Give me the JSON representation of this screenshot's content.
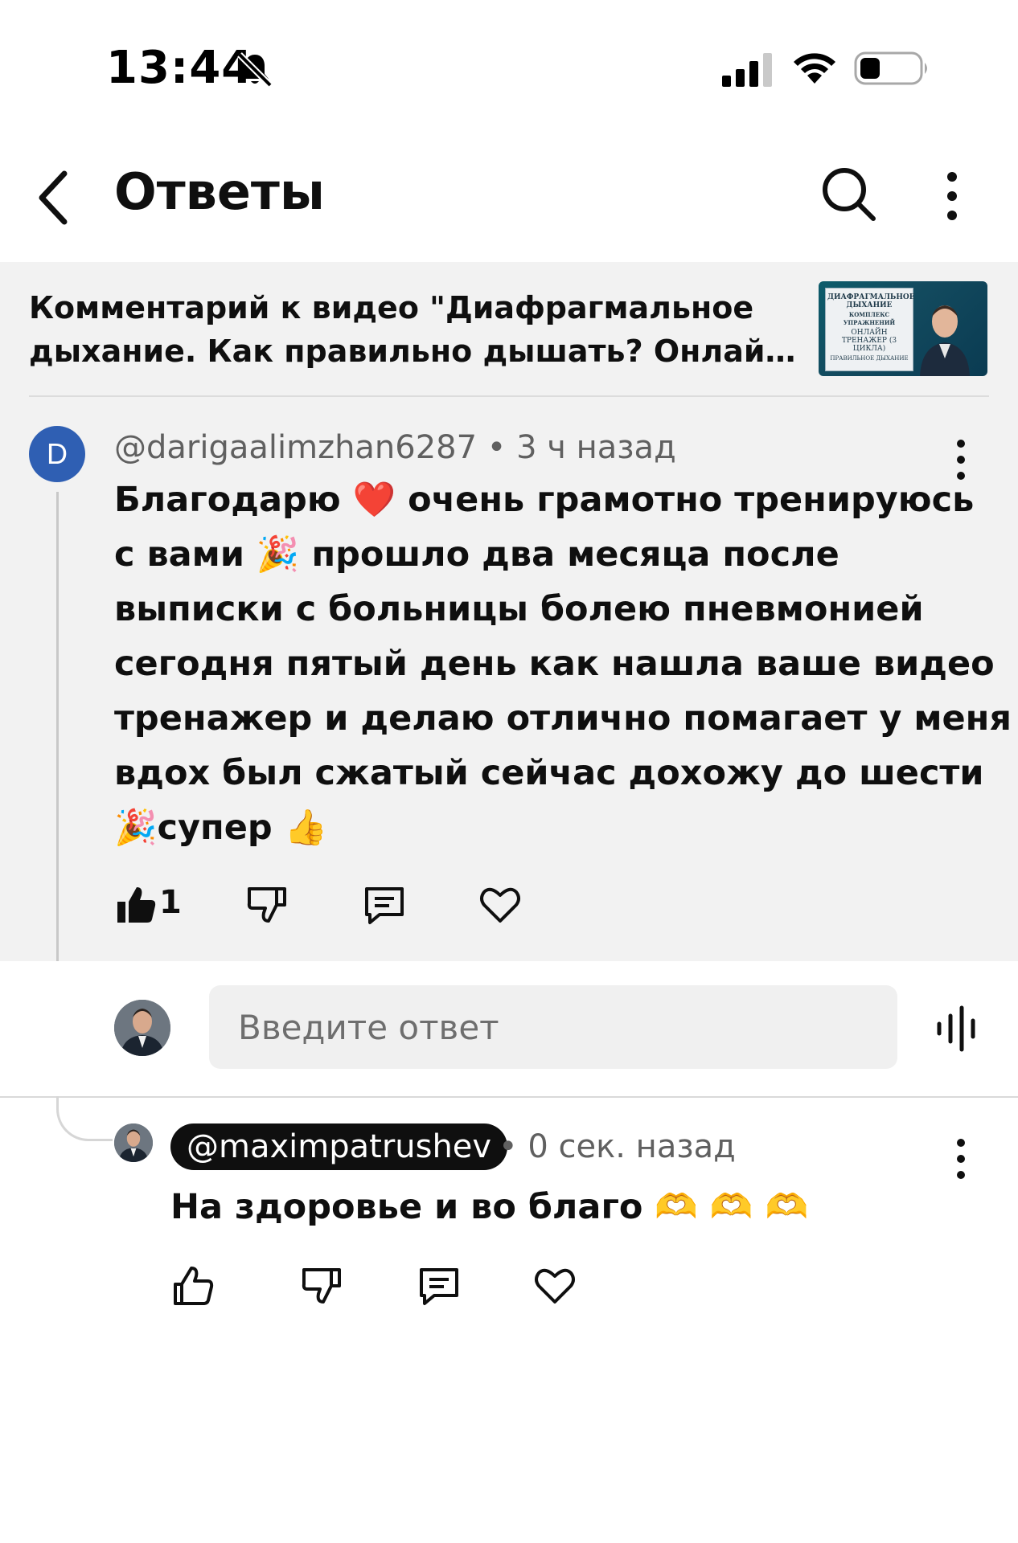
{
  "status_bar": {
    "time": "13:44",
    "icons": [
      "bell-slash-icon",
      "cellular-signal-icon",
      "wifi-icon",
      "battery-icon"
    ]
  },
  "header": {
    "title": "Ответы",
    "icons": [
      "back-arrow-icon",
      "search-icon",
      "more-vertical-icon"
    ]
  },
  "video": {
    "title_line1": "Комментарий к видео \"Диафрагмальное",
    "title_line2": "дыхание. Как правильно дышать? Онлайн-т...",
    "thumbnail": {
      "line1": "ДИАФРАГМАЛЬНОЕ ДЫХАНИЕ",
      "line2": "КОМПЛЕКС УПРАЖНЕНИЙ",
      "line3": "ОНЛАЙН ТРЕНАЖЕР (3 ЦИКЛА)",
      "line4": "ПРАВИЛЬНОЕ ДЫХАНИЕ"
    }
  },
  "comment": {
    "avatar_letter": "D",
    "author": "@darigaalimzhan6287",
    "separator": "•",
    "time": "3 ч назад",
    "lines": [
      "Благодарю ❤️ очень грамотно тренируюсь",
      "с вами 🎉 прошло два месяца после",
      "выписки с больницы болею пневмонией",
      "сегодня пятый день как нашла ваше видео",
      "тренажер и делаю отлично помагает  у меня",
      "вдох был сжатый сейчас дохожу до шести",
      "🎉супер 👍"
    ],
    "like_count": "1",
    "actions": [
      "thumbs-up-filled-icon",
      "thumbs-down-icon",
      "reply-icon",
      "heart-icon"
    ]
  },
  "reply_input": {
    "placeholder": "Введите ответ",
    "icons": [
      "user-avatar",
      "voice-input-icon"
    ]
  },
  "reply": {
    "author": "@maximpatrushev",
    "separator": "•",
    "time": "0 сек. назад",
    "text": "На здоровье и во благо 🫶 🫶 🫶",
    "actions": [
      "thumbs-up-icon",
      "thumbs-down-icon",
      "reply-icon",
      "heart-icon"
    ]
  },
  "colors": {
    "panel_bg": "#f2f2f2",
    "avatar_blue": "#2f5fb3",
    "chip_bg": "#0f0f0f",
    "meta_text": "#606060"
  }
}
